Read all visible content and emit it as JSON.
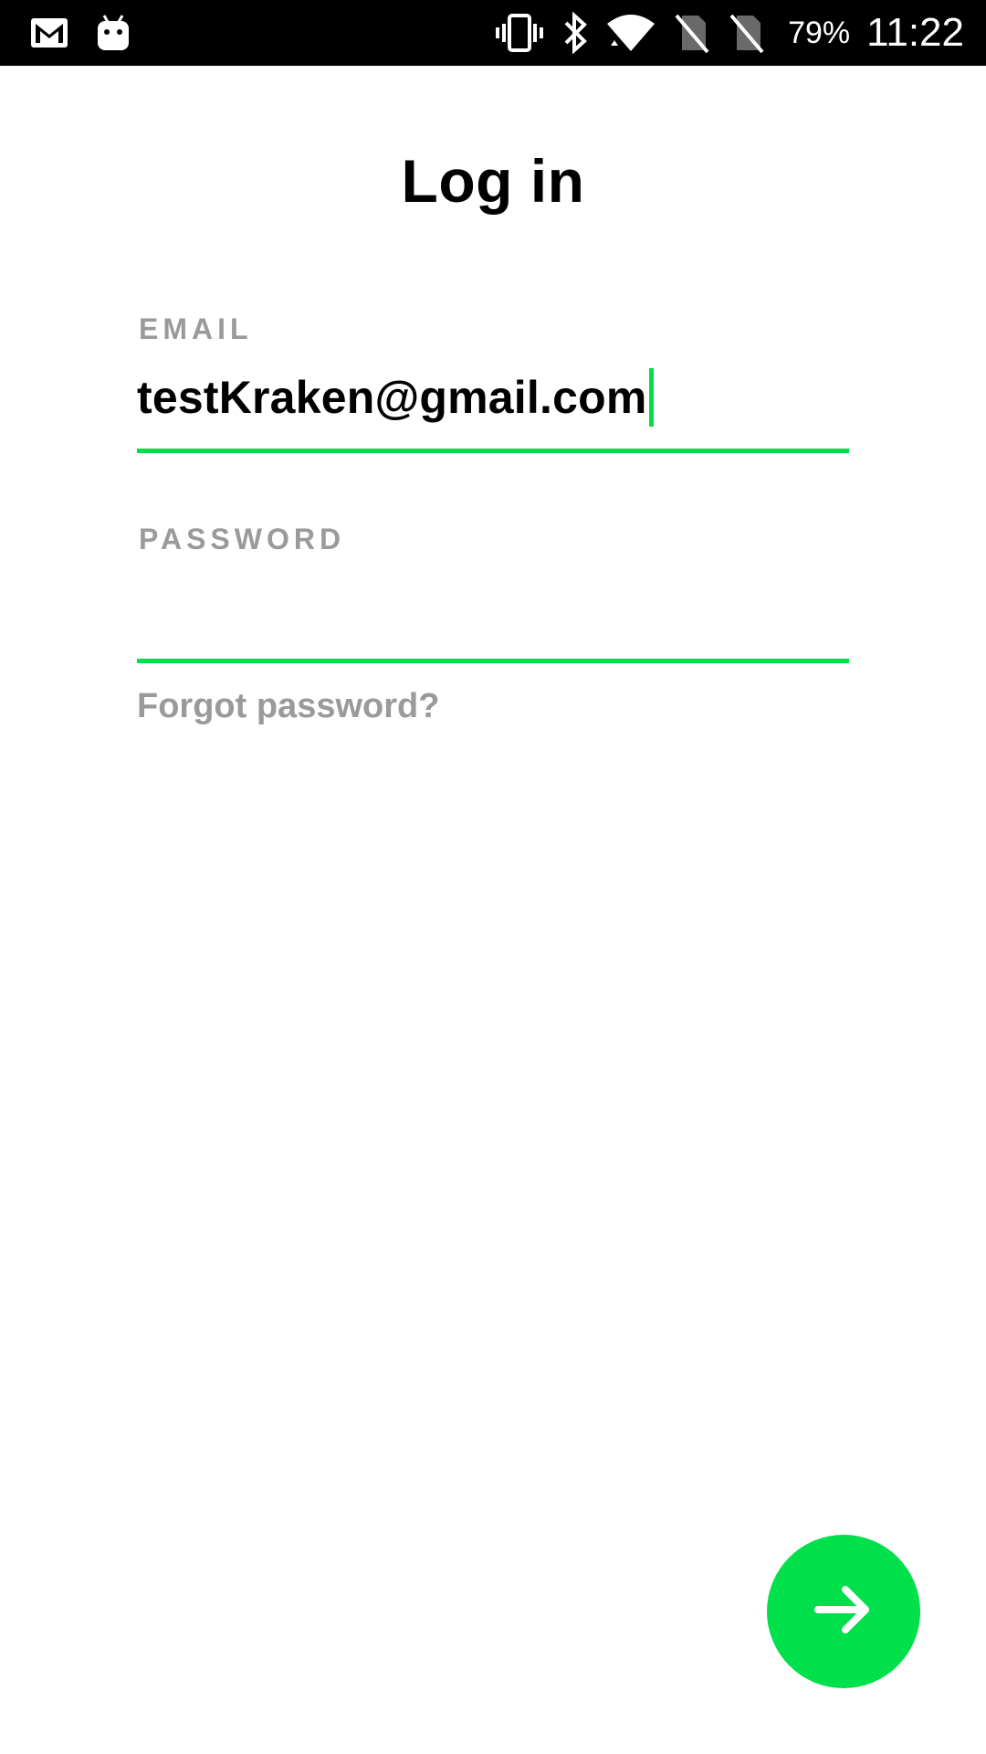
{
  "status_bar": {
    "battery_percent": "79%",
    "time": "11:22",
    "left_icons": [
      "gmail-icon",
      "android-icon"
    ],
    "right_icons": [
      "vibrate-icon",
      "bluetooth-icon",
      "wifi-icon",
      "no-sim-icon",
      "no-sim-icon"
    ]
  },
  "screen": {
    "title": "Log in",
    "email": {
      "label": "EMAIL",
      "value": "testKraken@gmail.com"
    },
    "password": {
      "label": "PASSWORD",
      "value": ""
    },
    "forgot_password": "Forgot password?",
    "next_button_icon": "arrow-right-icon"
  },
  "colors": {
    "accent": "#00e04b",
    "label_gray": "#9a9a9a",
    "text": "#000000",
    "status_bar": "#000000"
  }
}
